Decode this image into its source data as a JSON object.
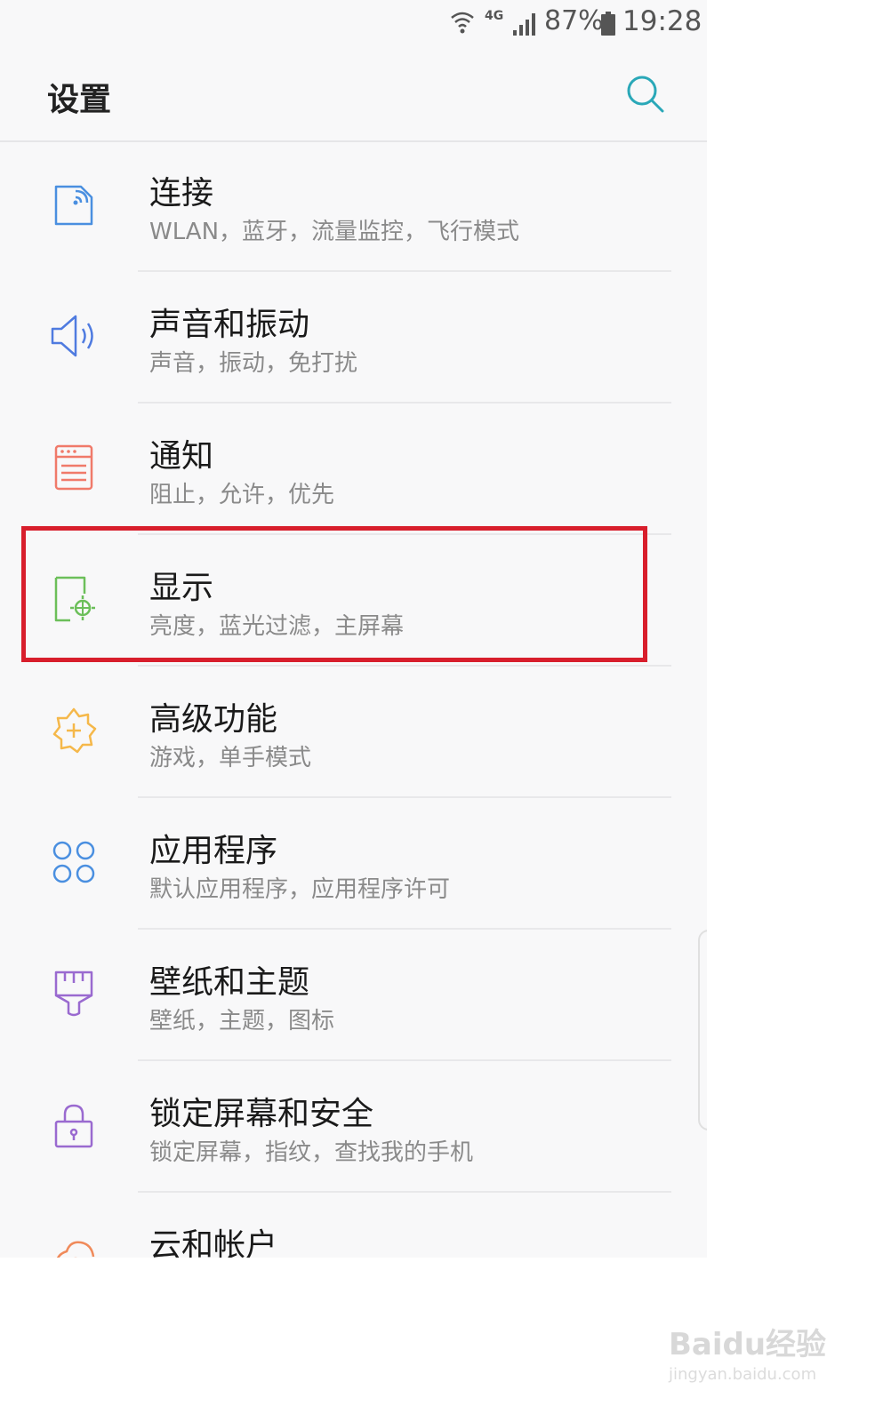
{
  "status_bar": {
    "network_type": "4G",
    "battery_percent": "87%",
    "time": "19:28",
    "icons": [
      "wifi-icon",
      "signal-icon",
      "battery-icon"
    ]
  },
  "header": {
    "title": "设置",
    "search_icon": "search-icon"
  },
  "settings_items": [
    {
      "label": "连接",
      "subtitle": "WLAN，蓝牙，流量监控，飞行模式",
      "icon": "connection-icon",
      "icon_color": "#4a8fe0"
    },
    {
      "label": "声音和振动",
      "subtitle": "声音，振动，免打扰",
      "icon": "speaker-icon",
      "icon_color": "#4f7be0"
    },
    {
      "label": "通知",
      "subtitle": "阻止，允许，优先",
      "icon": "notification-icon",
      "icon_color": "#f07a6a"
    },
    {
      "label": "显示",
      "subtitle": "亮度，蓝光过滤，主屏幕",
      "icon": "display-icon",
      "icon_color": "#6cbf5a"
    },
    {
      "label": "高级功能",
      "subtitle": "游戏，单手模式",
      "icon": "advanced-features-icon",
      "icon_color": "#f5b84a"
    },
    {
      "label": "应用程序",
      "subtitle": "默认应用程序，应用程序许可",
      "icon": "apps-icon",
      "icon_color": "#4a8fe0"
    },
    {
      "label": "壁纸和主题",
      "subtitle": "壁纸，主题，图标",
      "icon": "brush-icon",
      "icon_color": "#9a6ad0"
    },
    {
      "label": "锁定屏幕和安全",
      "subtitle": "锁定屏幕，指纹，查找我的手机",
      "icon": "lock-icon",
      "icon_color": "#9a6ad0"
    },
    {
      "label": "云和帐户",
      "subtitle": "",
      "icon": "cloud-account-icon",
      "icon_color": "#f08a5a"
    }
  ],
  "highlighted_item": "显示",
  "highlight_color": "#d81e2c",
  "watermark": {
    "logo_text": "Baidu经验",
    "site": "jingyan.baidu.com"
  }
}
